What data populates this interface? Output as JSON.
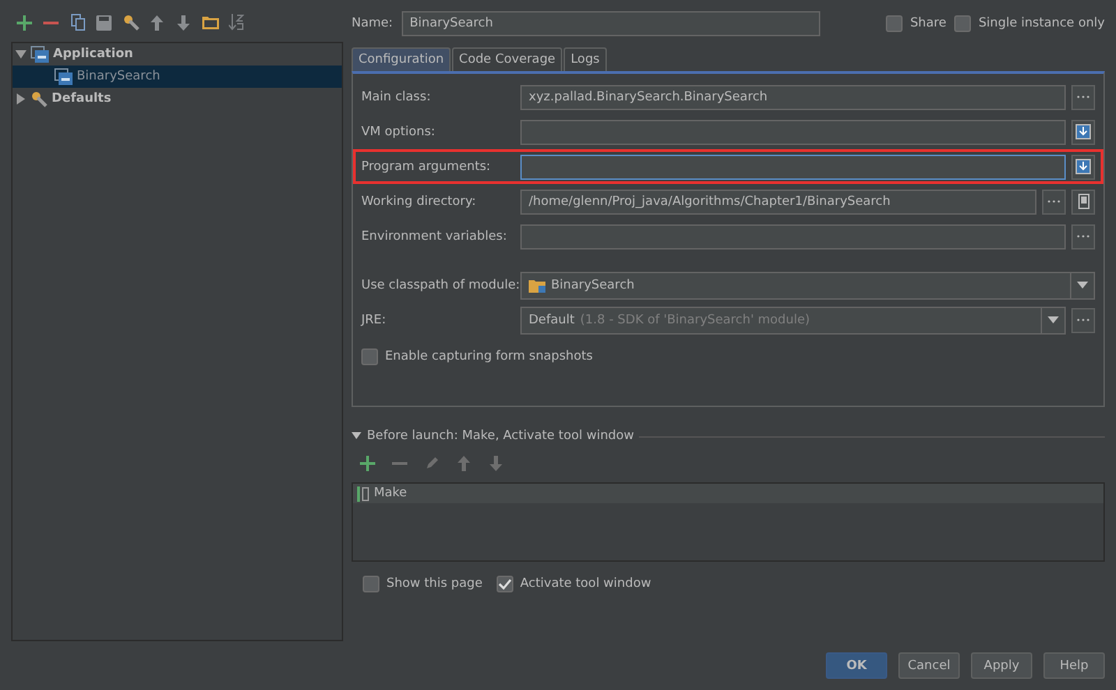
{
  "sidebar": {
    "toolbar": [
      {
        "kind": "add"
      },
      {
        "kind": "remove"
      },
      {
        "kind": "copy"
      },
      {
        "kind": "save"
      },
      {
        "kind": "wrench"
      },
      {
        "kind": "up"
      },
      {
        "kind": "down"
      },
      {
        "kind": "folder"
      },
      {
        "kind": "sort"
      }
    ],
    "tree": [
      {
        "label": "Application",
        "kind": "app",
        "expanded": true,
        "selected": false,
        "children": [
          {
            "label": "BinarySearch",
            "kind": "app",
            "selected": true
          }
        ]
      },
      {
        "label": "Defaults",
        "kind": "wrench",
        "expanded": false,
        "selected": false
      }
    ]
  },
  "name": {
    "label": "Name:",
    "value": "BinarySearch"
  },
  "options": [
    {
      "label": "Share",
      "checked": false
    },
    {
      "label": "Single instance only",
      "checked": false
    }
  ],
  "tabs": [
    {
      "label": "Configuration",
      "selected": true
    },
    {
      "label": "Code Coverage",
      "selected": false
    },
    {
      "label": "Logs",
      "selected": false
    }
  ],
  "fields": [
    {
      "label": "Main class:",
      "kind": "text",
      "value": "xyz.pallad.BinarySearch.BinarySearch",
      "buttons": [
        {
          "kind": "dots"
        }
      ],
      "highlighted": false,
      "focused": false
    },
    {
      "label": "VM options:",
      "kind": "text",
      "buttons": [
        {
          "kind": "expand"
        }
      ],
      "highlighted": false,
      "focused": false
    },
    {
      "label": "Program arguments:",
      "kind": "text",
      "buttons": [
        {
          "kind": "expand"
        }
      ],
      "highlighted": true,
      "focused": true
    },
    {
      "label": "Working directory:",
      "kind": "text",
      "value": "/home/glenn/Proj_java/Algorithms/Chapter1/BinarySearch",
      "buttons": [
        {
          "kind": "dots"
        },
        {
          "kind": "device"
        }
      ],
      "highlighted": false,
      "focused": false
    },
    {
      "label": "Environment variables:",
      "kind": "text",
      "buttons": [
        {
          "kind": "dots"
        }
      ],
      "highlighted": false,
      "focused": false
    },
    {
      "label": "Use classpath of module:",
      "kind": "module",
      "value": "BinarySearch",
      "highlighted": false
    },
    {
      "label": "JRE:",
      "kind": "jre",
      "value": "Default",
      "detail": "(1.8 - SDK of 'BinarySearch' module)",
      "buttons": [
        {
          "kind": "dots"
        }
      ],
      "highlighted": false
    }
  ],
  "snapshot": {
    "label": "Enable capturing form snapshots",
    "checked": false
  },
  "before_launch": {
    "title": "Before launch: Make, Activate tool window",
    "expanded": true,
    "toolbar": [
      {
        "kind": "add",
        "disabled": false
      },
      {
        "kind": "remove",
        "disabled": true
      },
      {
        "kind": "edit",
        "disabled": true
      },
      {
        "kind": "up",
        "disabled": true
      },
      {
        "kind": "down",
        "disabled": true
      }
    ],
    "items": [
      {
        "label": "Make"
      }
    ]
  },
  "launch_options": [
    {
      "label": "Show this page",
      "checked": false
    },
    {
      "label": "Activate tool window",
      "checked": true
    }
  ],
  "buttons": [
    {
      "label": "OK",
      "default": true
    },
    {
      "label": "Cancel",
      "default": false
    },
    {
      "label": "Apply",
      "default": false
    },
    {
      "label": "Help",
      "default": false
    }
  ]
}
